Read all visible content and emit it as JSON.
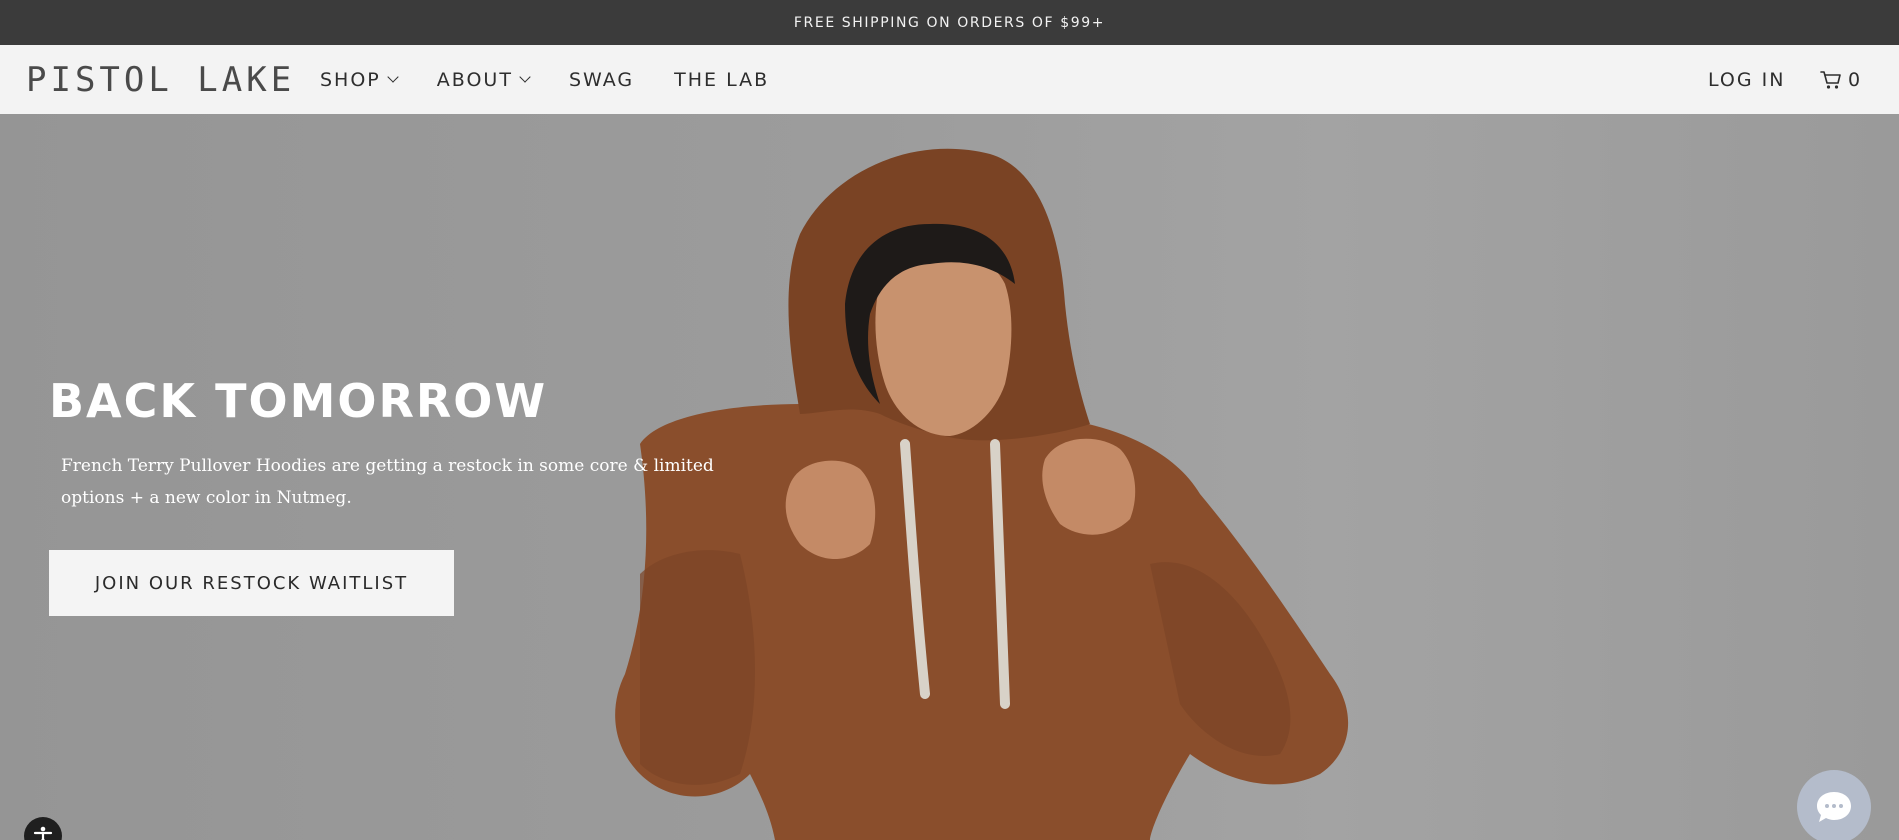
{
  "announcement": {
    "text": "FREE SHIPPING ON ORDERS OF $99+"
  },
  "header": {
    "logo": "PISTOL LAKE",
    "nav": [
      {
        "label": "SHOP",
        "has_dropdown": true
      },
      {
        "label": "ABOUT",
        "has_dropdown": true
      },
      {
        "label": "SWAG",
        "has_dropdown": false
      },
      {
        "label": "THE LAB",
        "has_dropdown": false
      }
    ],
    "login": "LOG IN",
    "cart_count": "0",
    "cart_icon": "cart-icon"
  },
  "hero": {
    "title": "BACK TOMORROW",
    "text": "French Terry Pullover Hoodies are getting a restock in some core & limited options + a new color in Nutmeg.",
    "cta": "JOIN OUR RESTOCK WAITLIST"
  },
  "widgets": {
    "accessibility_icon": "accessibility-icon",
    "chat_icon": "chat-icon"
  },
  "colors": {
    "announcement_bg": "#3b3b3b",
    "header_bg": "#f3f3f3",
    "hoodie": "#8a4e2c",
    "chat_bubble": "#b4bccb"
  }
}
